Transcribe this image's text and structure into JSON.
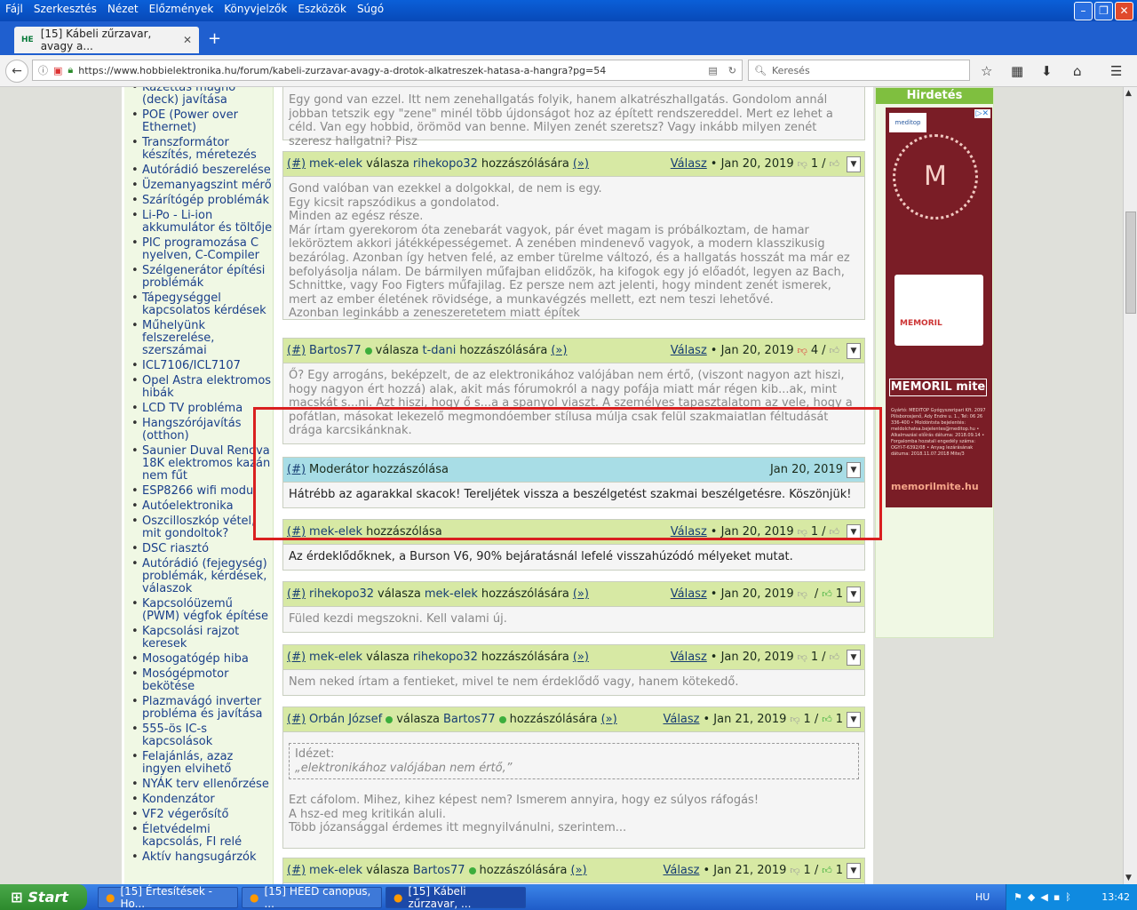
{
  "menu": [
    "Fájl",
    "Szerkesztés",
    "Nézet",
    "Előzmények",
    "Könyvjelzők",
    "Eszközök",
    "Súgó"
  ],
  "tab": {
    "title": "[15] Kábeli zűrzavar, avagy a...",
    "favicon": "HE"
  },
  "url": "https://www.hobbielektronika.hu/forum/kabeli-zurzavar-avagy-a-drotok-alkatreszek-hatasa-a-hangra?pg=54",
  "search_placeholder": "Keresés",
  "sidebar": [
    "Kazettás magnó (deck) javítása",
    "POE (Power over Ethernet)",
    "Transzformátor készítés, méretezés",
    "Autórádió beszerelése",
    "Üzemanyagszint mérő",
    "Szárítógép problémák",
    "Li-Po - Li-ion akkumulátor és töltője",
    "PIC programozása C nyelven, C-Compiler",
    "Szélgenerátor építési problémák",
    "Tápegységgel kapcsolatos kérdések",
    "Műhelyünk felszerelése, szerszámai",
    "ICL7106/ICL7107",
    "Opel Astra elektromos hibák",
    "LCD TV probléma",
    "Hangszórójavítás (otthon)",
    "Saunier Duval Renova 18K elektromos kazán nem fűt",
    "ESP8266 wifi modul",
    "Autóelektronika",
    "Oszcilloszkóp vétel, mit gondoltok?",
    "DSC riasztó",
    "Autórádió (fejegység) problémák, kérdések, válaszok",
    "Kapcsolóüzemű (PWM) végfok építése",
    "Kapcsolási rajzot keresek",
    "Mosogatógép hiba",
    "Mosógépmotor bekötése",
    "Plazmavágó inverter probléma és javítása",
    "555-ös IC-s kapcsolások",
    "Felajánlás, azaz ingyen elvihető",
    "NYÁK terv ellenőrzése",
    "Kondenzátor",
    "VF2 végerősítő",
    "Életvédelmi kapcsolás, FI relé",
    "Aktív hangsugárzók"
  ],
  "top_snippet": "Egy gond van ezzel. Itt nem zenehallgatás folyik, hanem alkatrészhallgatás. Gondolom annál jobban tetszik egy \"zene\" minél több újdonságot hoz az épített rendszereddel. Mert ez lehet a céld. Van egy hobbid, örömöd van benne. Milyen zenét szeretsz? Vagy inkább milyen zenét szeresz hallgatni? Pisz",
  "posts": [
    {
      "hash": "(#)",
      "user": "mek-elek",
      "mid": " válasza ",
      "target": "rihekopo32",
      "suffix": " hozzászólására",
      "link": "(»)",
      "reply": "Válasz",
      "date": "• Jan 20, 2019",
      "score": "1",
      "score2": "",
      "body": "Gond valóban van ezekkel a dolgokkal, de nem is egy.\nEgy kicsit rapszódikus a gondolatod.\nMinden az egész része.\nMár írtam gyerekorom óta zenebarát vagyok, pár évet magam is próbálkoztam, de hamar leköröztem akkori játékképességemet. A zenében mindenevő vagyok, a modern klasszikusig bezárólag. Azonban így hetven felé, az ember türelme változó, és a hallgatás hosszát ma már ez befolyásolja nálam. De bármilyen műfajban elidőzök, ha kifogok egy jó előadót, legyen az Bach, Schnittke, vagy Foo Figters műfajilag. Ez persze nem azt jelenti, hogy mindent zenét ismerek, mert az ember életének rövidsége, a munkavégzés mellett, ezt nem teszi lehetővé.\nAzonban leginkább a zeneszeretetem miatt építek"
    },
    {
      "hash": "(#)",
      "user": "Bartos77",
      "mid": " válasza ",
      "target": "t-dani",
      "suffix": " hozzászólására",
      "link": "(»)",
      "reply": "Válasz",
      "date": "• Jan 20, 2019",
      "score": "4",
      "score2": "",
      "body": "Ő? Egy arrogáns, beképzelt, de az elektronikához valójában nem értő, (viszont nagyon azt hiszi, hogy nagyon ért hozzá) alak, akit más fórumokról a nagy pofája miatt már régen kib...ak, mint macskát s...ni. Azt hiszi, hogy ő s...a a spanyol viaszt. A személyes tapasztalatom az vele, hogy a pofátlan, másokat lekezelő megmondóember stílusa múlja csak felül szakmaiatlan féltudását drága karcsikánknak."
    },
    {
      "hash": "(#)",
      "title": "Moderátor hozzászólása",
      "date": "Jan 20, 2019",
      "body": "Hátrébb az agarakkal skacok! Tereljétek vissza a beszélgetést szakmai beszélgetésre. Köszönjük!"
    },
    {
      "hash": "(#)",
      "user": "mek-elek",
      "suffix": " hozzászólása",
      "reply": "Válasz",
      "date": "• Jan 20, 2019",
      "score": "1",
      "score2": "",
      "body": "Az érdeklődőknek, a Burson V6, 90% bejáratásnál lefelé visszahúzódó mélyeket mutat."
    },
    {
      "hash": "(#)",
      "user": "rihekopo32",
      "mid": " válasza ",
      "target": "mek-elek",
      "suffix": " hozzászólására",
      "link": "(»)",
      "reply": "Válasz",
      "date": "• Jan 20, 2019",
      "score": "",
      "score2": "1",
      "body": "Füled kezdi megszokni. Kell valami új."
    },
    {
      "hash": "(#)",
      "user": "mek-elek",
      "mid": " válasza ",
      "target": "rihekopo32",
      "suffix": " hozzászólására",
      "link": "(»)",
      "reply": "Válasz",
      "date": "• Jan 20, 2019",
      "score": "1",
      "score2": "",
      "body": "Nem neked írtam a fentieket, mivel te nem érdeklődő vagy, hanem kötekedő."
    },
    {
      "hash": "(#)",
      "user": "Orbán József",
      "mid": " válasza ",
      "target": "Bartos77",
      "suffix": " hozzászólására",
      "link": "(»)",
      "reply": "Válasz",
      "date": "• Jan 21, 2019",
      "score": "1",
      "score2": "1",
      "quote_label": "Idézet:",
      "quote": "„elektronikához valójában nem értő,”",
      "body": "Ezt cáfolom. Mihez, kihez képest nem? Ismerem annyira, hogy ez súlyos ráfogás!\nA hsz-ed meg kritikán aluli.\nTöbb józansággal érdemes itt megnyilvánulni, szerintem..."
    },
    {
      "hash": "(#)",
      "user": "mek-elek",
      "mid": " válasza ",
      "target": "Bartos77",
      "suffix": " hozzászólására",
      "link": "(»)",
      "reply": "Válasz",
      "date": "• Jan 21, 2019",
      "score": "1",
      "score2": "1",
      "body": ""
    }
  ],
  "ad": {
    "header": "Hirdetés",
    "brand": "MEMORIL mite",
    "url": "memorilmite.hu",
    "product": "MEMORIL",
    "logo": "meditop",
    "small": "Gyártó: MEDITOP Gyógyszeripari Kft. 2097 Pilisborosjenő, Ady Endre u. 1., Tel: 06 26 336-400 • Moldóntsta bejelentés: meldolchatsa.bejelentes@meditop.hu • Alkalmazási előírás dátuma: 2018.09.14 • Forgalomba hozatali engedély száma: OGYI-T-6392/08 • Anyag lezárásának dátuma: 2018.11.07.2018 Mite/3"
  },
  "taskbar": {
    "start": "Start",
    "tasks": [
      "[15] Értesítések - Ho...",
      "[15] HEED canopus, ...",
      "[15] Kábeli zűrzavar, ..."
    ],
    "lang": "HU",
    "clock": "13:42"
  }
}
